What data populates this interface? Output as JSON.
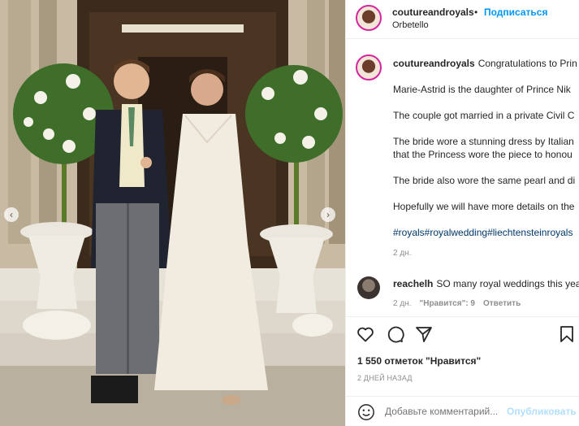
{
  "post": {
    "username": "coutureandroyals",
    "follow_label": "Подписаться",
    "location": "Orbetello"
  },
  "caption": {
    "username": "coutureandroyals",
    "lines": [
      "Congratulations to Prin",
      "Marie-Astrid is the daughter of Prince Nik",
      "The couple got married in a private Civil C",
      "The bride wore a stunning dress by Italian",
      "that the Princess wore the piece to honou",
      "The bride also wore the same pearl and di",
      "Hopefully we will have more details on the"
    ],
    "hashtags": "#royals#royalwedding#liechtensteinroyals",
    "time": "2 дн."
  },
  "comment": {
    "username": "reachelh",
    "text": "SO many royal weddings this yea",
    "time": "2 дн.",
    "likes": "\"Нравится\": 9",
    "reply": "Ответить"
  },
  "actions": {
    "like_icon": "heart-icon",
    "comment_icon": "comment-icon",
    "share_icon": "share-icon",
    "save_icon": "bookmark-icon"
  },
  "likes_count": "1 550 отметок \"Нравится\"",
  "posted_ago": "2 ДНЕЙ НАЗАД",
  "add_comment": {
    "placeholder": "Добавьте комментарий...",
    "publish_label": "Опубликовать"
  },
  "colors": {
    "accent": "#0095f6",
    "hashtag": "#00376b",
    "muted": "#8e8e8e",
    "publish_disabled": "#b2dffc"
  }
}
